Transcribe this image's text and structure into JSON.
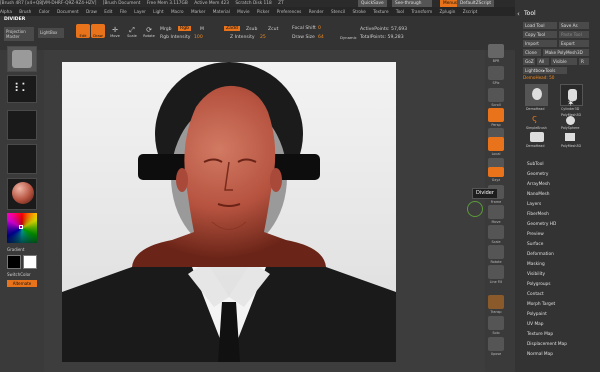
{
  "titlebar": {
    "items": [
      "[Brush 4R7 [x4+Q8JVM-DHRF-Q9Z-9Z4-HZV]",
      "[Brush Document",
      "Free Mem 3.117GB",
      "Active Mem 423",
      "Scratch Disk 118",
      "ZT"
    ],
    "quicksave": "QuickSave",
    "seethrough": "See-through",
    "menus_label": "Menus",
    "default_script": "DefaultZScript"
  },
  "menubar": [
    "Alpha",
    "Brush",
    "Color",
    "Document",
    "Draw",
    "Edit",
    "File",
    "Layer",
    "Light",
    "Macro",
    "Marker",
    "Material",
    "Movie",
    "Picker",
    "Preferences",
    "Render",
    "Stencil",
    "Stroke",
    "Texture",
    "Tool",
    "Transform",
    "Zplugin",
    "Zscript"
  ],
  "doc_label": "DIVIDER",
  "topbar": {
    "projection": "Projection Master",
    "lightbox": "LightBox",
    "edit": "Edit",
    "draw": "Draw",
    "move": "Move",
    "scale": "Scale",
    "rotate": "Rotate",
    "mrgb": "Mrgb",
    "rgb": "Rgb",
    "m": "M",
    "rgb_intensity_label": "Rgb Intensity",
    "rgb_intensity_value": "100",
    "zadd": "Zadd",
    "zsub": "Zsub",
    "zcut": "Zcut",
    "z_intensity_label": "Z Intensity",
    "z_intensity_value": "25",
    "focal_shift_label": "Focal Shift",
    "focal_shift_value": "0",
    "draw_size_label": "Draw Size",
    "draw_size_value": "64",
    "dynamic": "Dynamic",
    "active_points_label": "ActivePoints:",
    "active_points_value": "57,693",
    "total_points_label": "TotalPoints:",
    "total_points_value": "59,283"
  },
  "leftshelf": {
    "gradient": "Gradient",
    "switchcolor": "SwitchColor",
    "alternate": "Alternate"
  },
  "rightshelf": [
    "BPR",
    "SPix",
    "Scroll",
    "Zoom",
    "Actual",
    "AAHalf",
    "Persp",
    "Floor",
    "Local",
    "L.Sym",
    "Gxyz",
    "Frame",
    "Move",
    "Scale",
    "Rotate",
    "Line Fill",
    "PolyF",
    "Transp",
    "Ghost",
    "Solo",
    "Xpose"
  ],
  "tooltip": "Divider",
  "toolpanel": {
    "title": "Tool",
    "load_tool": "Load Tool",
    "save_as": "Save As",
    "copy_tool": "Copy Tool",
    "paste_tool": "Paste Tool",
    "import": "Import",
    "export": "Export",
    "clone": "Clone",
    "make_polymesh": "Make PolyMesh3D",
    "goz": "GoZ",
    "all": "All",
    "visible": "Visible",
    "r": "R",
    "lightbox_tools": "Lightbox▸Tools",
    "current_tool": "DemoHead: 50",
    "thumbs": [
      "DemoHead",
      "Cylinder3D",
      "PolyMesh3D",
      "SimpleBrush",
      "PolySphere",
      "DemoHead",
      "PolyMesh3D"
    ],
    "sections": [
      "SubTool",
      "Geometry",
      "ArrayMesh",
      "NanoMesh",
      "Layers",
      "FiberMesh",
      "Geometry HD",
      "Preview",
      "Surface",
      "Deformation",
      "Masking",
      "Visibility",
      "Polygroups",
      "Contact",
      "Morph Target",
      "Polypaint",
      "UV Map",
      "Texture Map",
      "Displacement Map",
      "Normal Map"
    ]
  },
  "colors": {
    "accent": "#e8731a",
    "skin": "#b5523f",
    "panel": "#333333"
  }
}
